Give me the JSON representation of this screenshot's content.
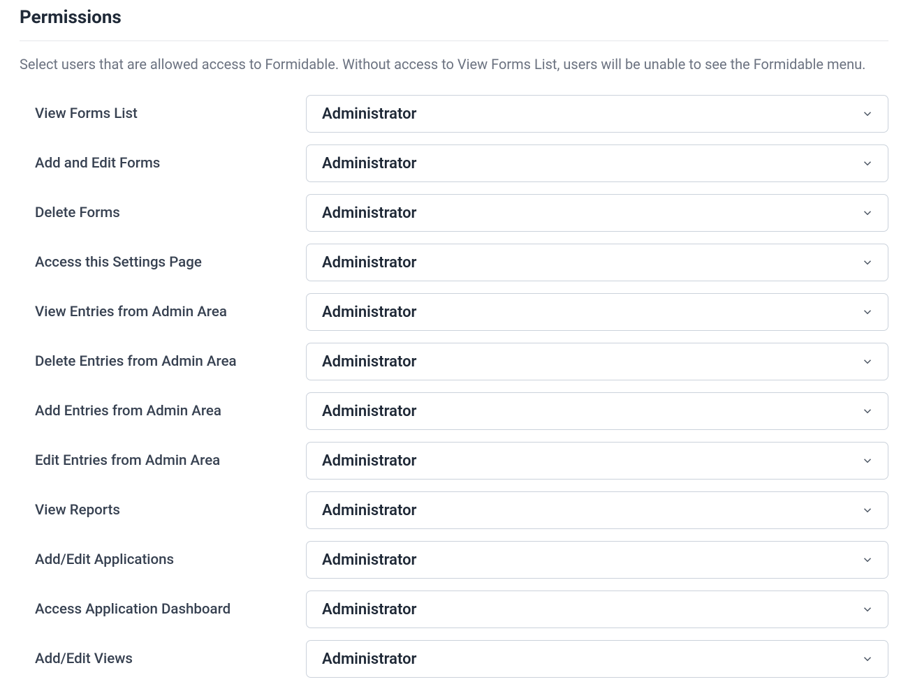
{
  "section": {
    "title": "Permissions",
    "description": "Select users that are allowed access to Formidable. Without access to View Forms List, users will be unable to see the Formidable menu."
  },
  "permissions": [
    {
      "label": "View Forms List",
      "value": "Administrator"
    },
    {
      "label": "Add and Edit Forms",
      "value": "Administrator"
    },
    {
      "label": "Delete Forms",
      "value": "Administrator"
    },
    {
      "label": "Access this Settings Page",
      "value": "Administrator"
    },
    {
      "label": "View Entries from Admin Area",
      "value": "Administrator"
    },
    {
      "label": "Delete Entries from Admin Area",
      "value": "Administrator"
    },
    {
      "label": "Add Entries from Admin Area",
      "value": "Administrator"
    },
    {
      "label": "Edit Entries from Admin Area",
      "value": "Administrator"
    },
    {
      "label": "View Reports",
      "value": "Administrator"
    },
    {
      "label": "Add/Edit Applications",
      "value": "Administrator"
    },
    {
      "label": "Access Application Dashboard",
      "value": "Administrator"
    },
    {
      "label": "Add/Edit Views",
      "value": "Administrator"
    }
  ]
}
